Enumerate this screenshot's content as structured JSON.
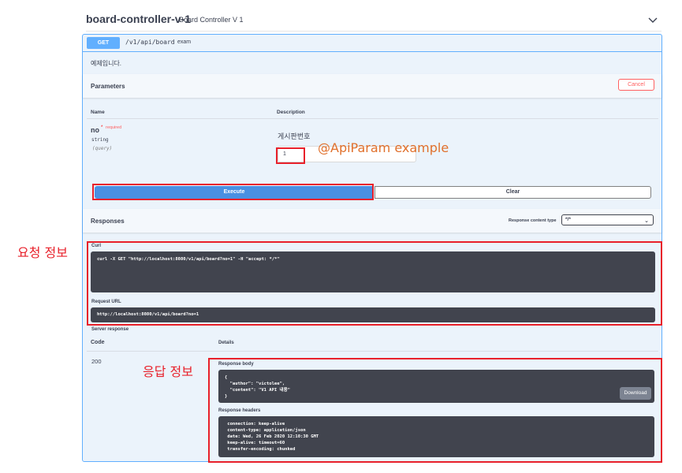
{
  "section": {
    "title": "board-controller-v-1",
    "description": "Board Controller V 1"
  },
  "operation": {
    "method": "GET",
    "path": "/v1/api/board",
    "summary": "exam",
    "description": "예제입니다."
  },
  "parameters": {
    "title": "Parameters",
    "cancel_label": "Cancel",
    "col_name": "Name",
    "col_description": "Description",
    "items": [
      {
        "name": "no",
        "required_star": "*",
        "required_label": "required",
        "type": "string",
        "in": "(query)",
        "description": "게시판번호",
        "value": "1"
      }
    ]
  },
  "actions": {
    "execute_label": "Execute",
    "clear_label": "Clear"
  },
  "responses": {
    "title": "Responses",
    "content_type_label": "Response content type",
    "content_type_value": "*/*",
    "curl_label": "Curl",
    "curl_command": "curl -X GET \"http://localhost:8080/v1/api/board?no=1\" -H \"accept: */*\"",
    "request_url_label": "Request URL",
    "request_url": "http://localhost:8080/v1/api/board?no=1",
    "server_response_label": "Server response",
    "col_code": "Code",
    "col_details": "Details",
    "status_code": "200",
    "body_label": "Response body",
    "body": "{\n  \"author\": \"victolee\",\n  \"content\": \"V1 API 내용\"\n}",
    "download_label": "Download",
    "headers_label": "Response headers",
    "headers": " connection: keep-alive\n content-type: application/json\n date: Wed, 26 Feb 2020 12:10:30 GMT\n keep-alive: timeout=60\n transfer-encoding: chunked"
  },
  "annotations": {
    "request_info": "요청 정보",
    "response_info": "응답 정보",
    "api_param": "@ApiParam example",
    "highlight_color": "#e8202a"
  }
}
